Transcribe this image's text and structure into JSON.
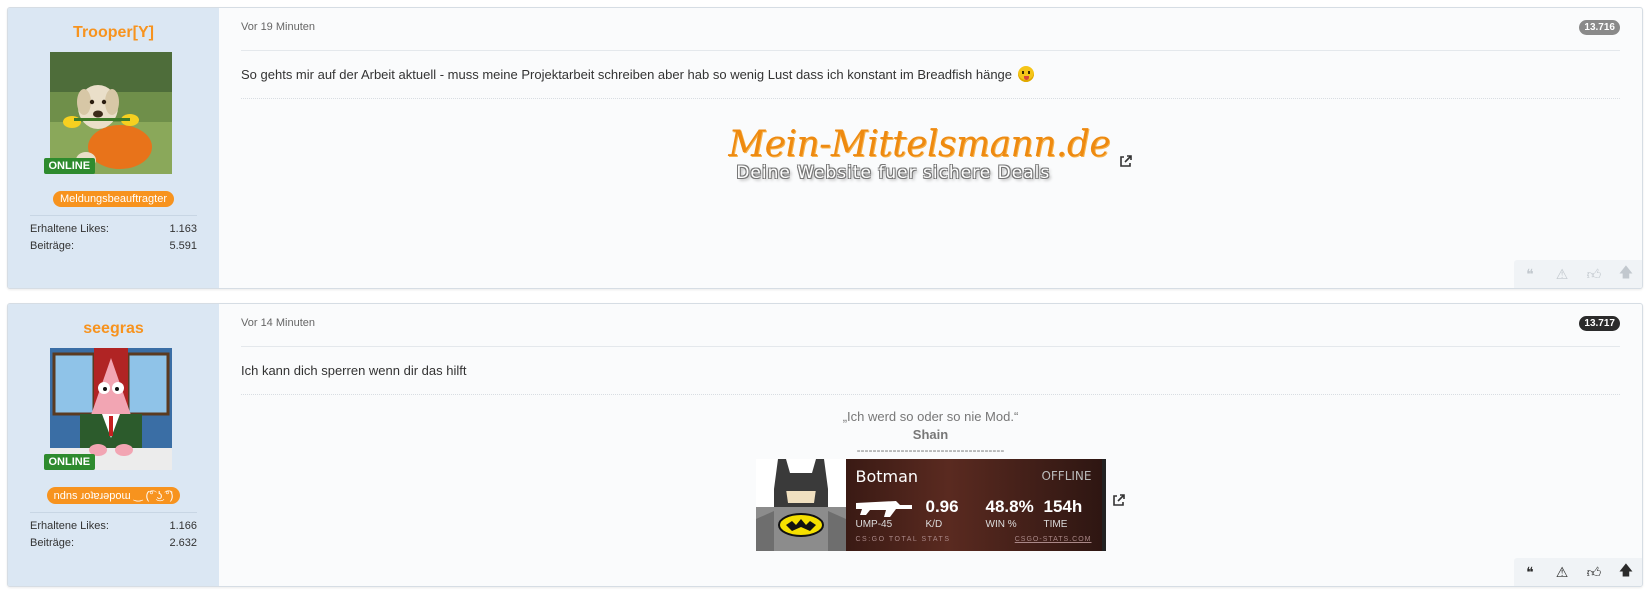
{
  "posts": [
    {
      "username": "Trooper[Y]",
      "online": "ONLINE",
      "rank": "Meldungsbeauftragter",
      "likes_label": "Erhaltene Likes:",
      "likes_value": "1.163",
      "posts_label": "Beiträge:",
      "posts_value": "5.591",
      "time": "Vor 19 Minuten",
      "number": "13.716",
      "number_color": "#8a8a8a",
      "text": "So gehts mir auf der Arbeit aktuell - muss meine Projektarbeit schreiben aber hab so wenig Lust dass ich konstant im Breadfish hänge",
      "emoji": "tongue-emoji",
      "signature_logo": "Mein-Mittelsmann.de",
      "signature_tagline": "Deine Website fuer sichere Deals"
    },
    {
      "username": "seegras",
      "online": "ONLINE",
      "rank": "ndns ɹoʇɐɹǝpoɯ ‿ (͡° ͜ʖ ͡°)",
      "likes_label": "Erhaltene Likes:",
      "likes_value": "1.166",
      "posts_label": "Beiträge:",
      "posts_value": "2.632",
      "time": "Vor 14 Minuten",
      "number": "13.717",
      "number_color": "#2b2b2b",
      "text": "Ich kann dich sperren wenn dir das hilft",
      "quote": "„Ich werd so oder so nie Mod.“",
      "quote_author": "Shain",
      "dashes": "-------------------------------------",
      "banner": {
        "name": "Botman",
        "status": "OFFLINE",
        "weapon": "UMP-45",
        "kd_value": "0.96",
        "kd_label": "K/D",
        "win_value": "48.8%",
        "win_label": "WIN %",
        "time_value": "154h",
        "time_label": "TIME",
        "footer_left": "CS:GO TOTAL STATS",
        "footer_right": "CSGO-STATS.COM"
      }
    }
  ],
  "colors": {
    "accent": "#f7931e",
    "online": "#2e8b2e",
    "sidebar": "#dbe7f3"
  },
  "action_icons": [
    "quote-icon",
    "report-icon",
    "like-icon",
    "scroll-up-icon"
  ]
}
